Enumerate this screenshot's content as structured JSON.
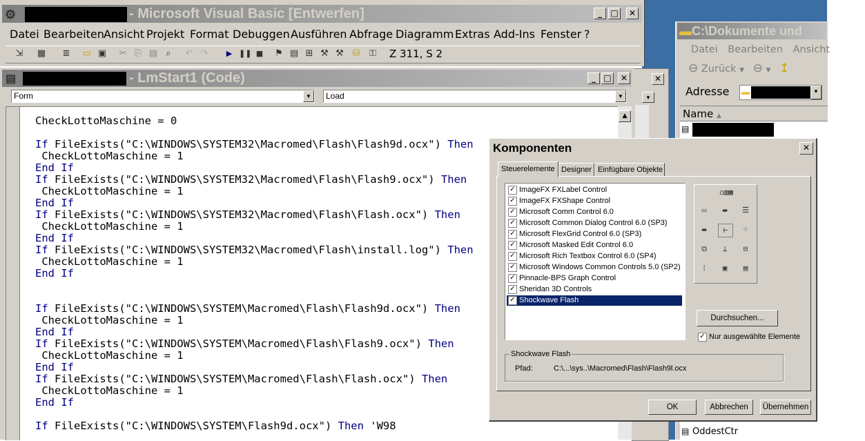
{
  "vb_main": {
    "title": "- Microsoft Visual Basic [Entwerfen]",
    "menu": [
      "Datei",
      "Bearbeiten",
      "Ansicht",
      "Projekt",
      "Format",
      "Debuggen",
      "Ausführen",
      "Abfrage",
      "Diagramm",
      "Extras",
      "Add-Ins",
      "Fenster",
      "?"
    ],
    "position": "Z 311, S 2"
  },
  "code_window": {
    "title": "- LmStart1 (Code)",
    "object_combo": "Form",
    "proc_combo": "Load",
    "lines": [
      "CheckLottoMaschine = 0",
      "",
      "If FileExists(\"C:\\WINDOWS\\SYSTEM32\\Macromed\\Flash\\Flash9d.ocx\") Then",
      " CheckLottoMaschine = 1",
      "End If",
      "If FileExists(\"C:\\WINDOWS\\SYSTEM32\\Macromed\\Flash\\Flash9.ocx\") Then",
      " CheckLottoMaschine = 1",
      "End If",
      "If FileExists(\"C:\\WINDOWS\\SYSTEM32\\Macromed\\Flash\\Flash.ocx\") Then",
      " CheckLottoMaschine = 1",
      "End If",
      "If FileExists(\"C:\\WINDOWS\\SYSTEM32\\Macromed\\Flash\\install.log\") Then",
      " CheckLottoMaschine = 1",
      "End If",
      "",
      "",
      "If FileExists(\"C:\\WINDOWS\\SYSTEM\\Macromed\\Flash\\Flash9d.ocx\") Then",
      " CheckLottoMaschine = 1",
      "End If",
      "If FileExists(\"C:\\WINDOWS\\SYSTEM\\Macromed\\Flash\\Flash9.ocx\") Then",
      " CheckLottoMaschine = 1",
      "End If",
      "If FileExists(\"C:\\WINDOWS\\SYSTEM\\Macromed\\Flash\\Flash.ocx\") Then",
      " CheckLottoMaschine = 1",
      "End If",
      "",
      "If FileExists(\"C:\\WINDOWS\\SYSTEM\\Flash9d.ocx\") Then 'W98"
    ]
  },
  "explorer": {
    "title": "C:\\Dokumente und",
    "menu": [
      "Datei",
      "Bearbeiten",
      "Ansicht"
    ],
    "back_label": "Zurück",
    "address_label": "Adresse",
    "column_name": "Name",
    "bottom_item": "OddestCtr"
  },
  "dialog": {
    "title": "Komponenten",
    "tabs": [
      "Steuerelemente",
      "Designer",
      "Einfügbare Objekte"
    ],
    "controls": [
      "ImageFX FXLabel Control",
      "ImageFX FXShape Control",
      "Microsoft Comm Control 6.0",
      "Microsoft Common Dialog Control 6.0 (SP3)",
      "Microsoft FlexGrid Control 6.0 (SP3)",
      "Microsoft Masked Edit Control 6.0",
      "Microsoft Rich Textbox Control 6.0 (SP4)",
      "Microsoft Windows Common Controls 5.0 (SP2)",
      "Pinnacle-BPS Graph Control",
      "Sheridan 3D Controls",
      "Shockwave Flash"
    ],
    "browse_button": "Durchsuchen...",
    "only_selected_label": "Nur ausgewählte Elemente",
    "group_title": "Shockwave Flash",
    "path_label": "Pfad:",
    "path_value": "C:\\...\\sys..\\Macromed\\Flash\\Flash9l.ocx",
    "ok_button": "OK",
    "cancel_button": "Abbrechen",
    "apply_button": "Übernehmen"
  },
  "colors": {
    "active_title": "#0a246a",
    "inactive_title": "#808080",
    "face": "#d4d0c8",
    "keyword": "#00007f",
    "desktop": "#3a6ea5"
  }
}
